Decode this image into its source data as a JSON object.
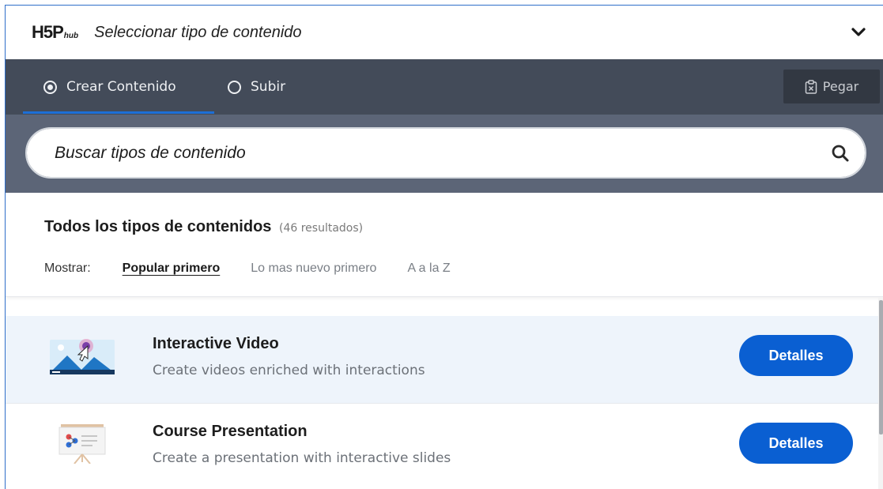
{
  "header": {
    "logo_main": "H5P",
    "logo_sub": "hub",
    "title": "Seleccionar tipo de contenido",
    "toggle_icon": "chevron-down-icon"
  },
  "tabs": [
    {
      "label": "Crear Contenido",
      "selected": true
    },
    {
      "label": "Subir",
      "selected": false
    }
  ],
  "paste": {
    "label": "Pegar",
    "icon": "clipboard-icon"
  },
  "search": {
    "placeholder": "Buscar tipos de contenido",
    "icon": "search-icon"
  },
  "results": {
    "title": "Todos los tipos de contenidos",
    "count": "(46 resultados)",
    "sort_label": "Mostrar:",
    "sort_options": [
      {
        "label": "Popular primero",
        "active": true
      },
      {
        "label": "Lo mas nuevo primero",
        "active": false
      },
      {
        "label": "A a la Z",
        "active": false
      }
    ]
  },
  "items": [
    {
      "name": "Interactive Video",
      "description": "Create videos enriched with interactions",
      "button": "Detalles",
      "icon": "interactive-video-icon"
    },
    {
      "name": "Course Presentation",
      "description": "Create a presentation with interactive slides",
      "button": "Detalles",
      "icon": "course-presentation-icon"
    }
  ],
  "colors": {
    "tabs_bg": "#434b59",
    "search_bg": "#5c6577",
    "accent": "#0a5fd2",
    "highlight_row": "#eef4fb"
  }
}
